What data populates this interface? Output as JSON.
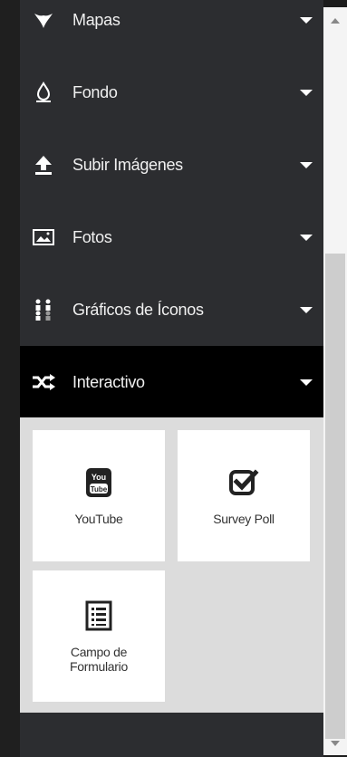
{
  "menu": {
    "items": [
      {
        "label": "Mapas",
        "icon": "map-icon"
      },
      {
        "label": "Fondo",
        "icon": "droplet-icon"
      },
      {
        "label": "Subir Imágenes",
        "icon": "upload-icon"
      },
      {
        "label": "Fotos",
        "icon": "image-icon"
      },
      {
        "label": "Gráficos de Íconos",
        "icon": "people-chart-icon"
      },
      {
        "label": "Interactivo",
        "icon": "shuffle-icon",
        "active": true
      }
    ]
  },
  "tiles": [
    {
      "label": "YouTube",
      "icon": "youtube-icon",
      "icon_text_top": "You",
      "icon_text_bottom": "Tube"
    },
    {
      "label": "Survey Poll",
      "icon": "checkbox-icon"
    },
    {
      "label_line1": "Campo de",
      "label_line2": "Formulario",
      "icon": "form-list-icon"
    }
  ],
  "colors": {
    "panel_bg": "#2c2d30",
    "active_bg": "#000000",
    "tiles_bg": "#dcdcdc",
    "tile_bg": "#ffffff"
  }
}
